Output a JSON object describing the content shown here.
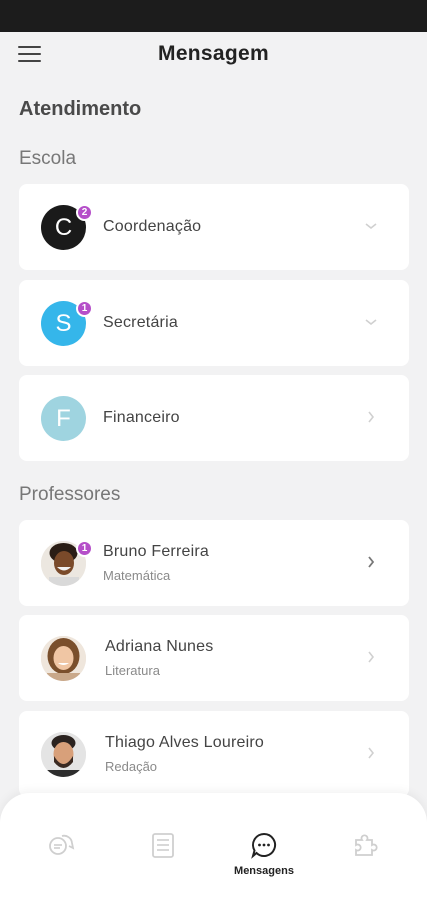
{
  "header": {
    "title": "Mensagem"
  },
  "section": {
    "title": "Atendimento"
  },
  "groups": {
    "escola": "Escola",
    "professores": "Professores"
  },
  "escola": [
    {
      "initial": "C",
      "name": "Coordenação",
      "badge": "2",
      "color": "#1a1a1a"
    },
    {
      "initial": "S",
      "name": "Secretária",
      "badge": "1",
      "color": "#35b6ea"
    },
    {
      "initial": "F",
      "name": "Financeiro",
      "color": "#9fd4e0"
    }
  ],
  "professores": [
    {
      "name": "Bruno Ferreira",
      "subject": "Matemática",
      "badge": "1"
    },
    {
      "name": "Adriana Nunes",
      "subject": "Literatura"
    },
    {
      "name": "Thiago Alves Loureiro",
      "subject": "Redação"
    }
  ],
  "nav": {
    "items": [
      {
        "icon": "chat-bubbles-icon"
      },
      {
        "icon": "clipboard-list-icon"
      },
      {
        "icon": "message-dots-icon",
        "label": "Mensagens",
        "active": true
      },
      {
        "icon": "puzzle-icon"
      }
    ]
  },
  "colors": {
    "badge": "#b54fc9",
    "background": "#f2f2f3"
  }
}
